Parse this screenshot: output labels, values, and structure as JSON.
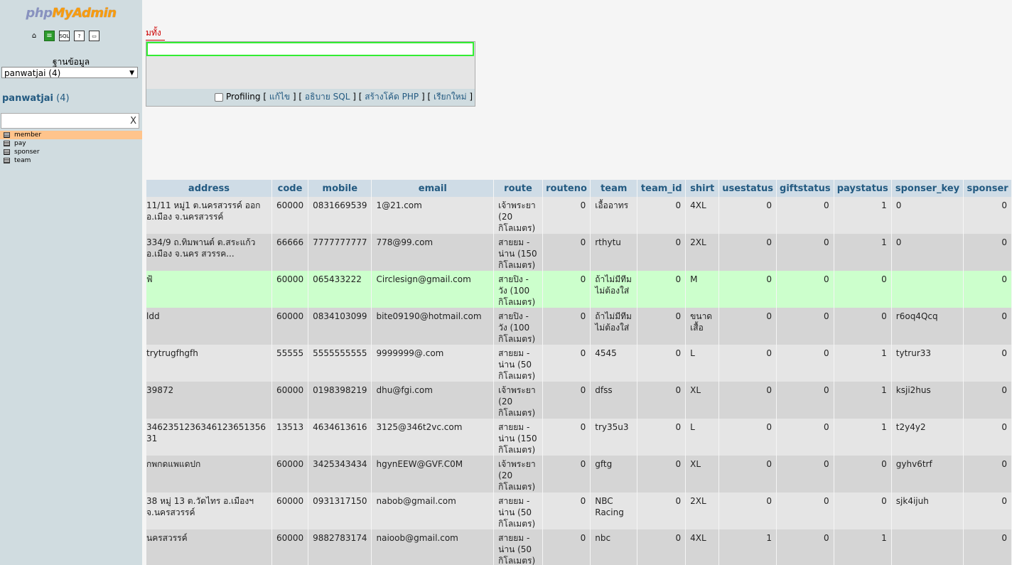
{
  "sidebar": {
    "logo": {
      "php": "php",
      "rest": "MyAdmin"
    },
    "nav_icons": [
      "home-icon",
      "database-icon",
      "sql-icon",
      "docs-icon",
      "console-icon"
    ],
    "db_label": "ฐานข้อมูล",
    "db_select_value": "panwatjai (4)",
    "db_name": "panwatjai",
    "db_count": "(4)",
    "filter_clear": "X",
    "tables": [
      "member",
      "pay",
      "sponser",
      "team"
    ]
  },
  "main": {
    "tab_label": "มทั้ง",
    "sql_footer": {
      "profiling": "Profiling",
      "edit": "แก้ไข",
      "explain": "อธิบาย SQL",
      "php_code": "สร้างโค้ด PHP",
      "refresh": "เรียกใหม่"
    }
  },
  "results": {
    "columns": [
      "address",
      "code",
      "mobile",
      "email",
      "route",
      "routeno",
      "team",
      "team_id",
      "shirt",
      "usestatus",
      "giftstatus",
      "paystatus",
      "sponser_key",
      "sponser"
    ],
    "rows": [
      [
        "11/11 หมู่1 ต.นครสวรรค์ ออก อ.เมือง จ.นครสวรรค์",
        "60000",
        "0831669539",
        "1@21.com",
        "เจ้าพระยา (20 กิโลเมตร)",
        "0",
        "เอื้ออาทร",
        "0",
        "4XL",
        "0",
        "0",
        "1",
        "0",
        "0"
      ],
      [
        "334/9 ถ.ทิมพานต์ ต.สระแก้ว อ.เมือง จ.นคร สวรรค...",
        "66666",
        "7777777777",
        "778@99.com",
        "สายยม - น่าน (150 กิโลเมตร)",
        "0",
        "rthytu",
        "0",
        "2XL",
        "0",
        "0",
        "1",
        "0",
        "0"
      ],
      [
        "ฟ้",
        "60000",
        "065433222",
        "Circlesign@gmail.com",
        "สายปิง - วัง (100 กิโลเมตร)",
        "0",
        "ถ้าไม่มีทีม ไม่ต้องใส่",
        "0",
        "M",
        "0",
        "0",
        "0",
        "",
        "0"
      ],
      [
        "ldd",
        "60000",
        "0834103099",
        "bite09190@hotmail.com",
        "สายปิง - วัง (100 กิโลเมตร)",
        "0",
        "ถ้าไม่มีทีม ไม่ต้องใส่",
        "0",
        "ขนาด เสื้อ",
        "0",
        "0",
        "0",
        "r6oq4Qcq",
        "0"
      ],
      [
        "trytrugfhgfh",
        "55555",
        "5555555555",
        "9999999@.com",
        "สายยม - น่าน (50 กิโลเมตร)",
        "0",
        "4545",
        "0",
        "L",
        "0",
        "0",
        "1",
        "tytrur33",
        "0"
      ],
      [
        "39872",
        "60000",
        "0198398219",
        "dhu@fgi.com",
        "เจ้าพระยา (20 กิโลเมตร)",
        "0",
        "dfss",
        "0",
        "XL",
        "0",
        "0",
        "1",
        "ksji2hus",
        "0"
      ],
      [
        "3462351236346123651356 31",
        "13513",
        "4634613616",
        "3125@346t2vc.com",
        "สายยม - น่าน (150 กิโลเมตร)",
        "0",
        "try35u3",
        "0",
        "L",
        "0",
        "0",
        "1",
        "t2y4y2",
        "0"
      ],
      [
        "กพกดแพแดปก",
        "60000",
        "3425343434",
        "hgynEEW@GVF.C0M",
        "เจ้าพระยา (20 กิโลเมตร)",
        "0",
        "gftg",
        "0",
        "XL",
        "0",
        "0",
        "0",
        "gyhv6trf",
        "0"
      ],
      [
        "38 หมู่ 13 ต.วัดไทร อ.เมืองฯ จ.นครสวรรค์",
        "60000",
        "0931317150",
        "nabob@gmail.com",
        "สายยม - น่าน (50 กิโลเมตร)",
        "0",
        "NBC Racing",
        "0",
        "2XL",
        "0",
        "0",
        "0",
        "sjk4ijuh",
        "0"
      ],
      [
        "นครสวรรค์",
        "60000",
        "9882783174",
        "naioob@gmail.com",
        "สายยม - น่าน (50 กิโลเมตร)",
        "0",
        "nbc",
        "0",
        "4XL",
        "1",
        "0",
        "1",
        "",
        "0"
      ]
    ]
  },
  "colors": {
    "sidebar_bg": "#d0dce0",
    "header_text": "#235a81",
    "highlight_row": "#ccffcc",
    "active_table": "#ffc48c"
  }
}
